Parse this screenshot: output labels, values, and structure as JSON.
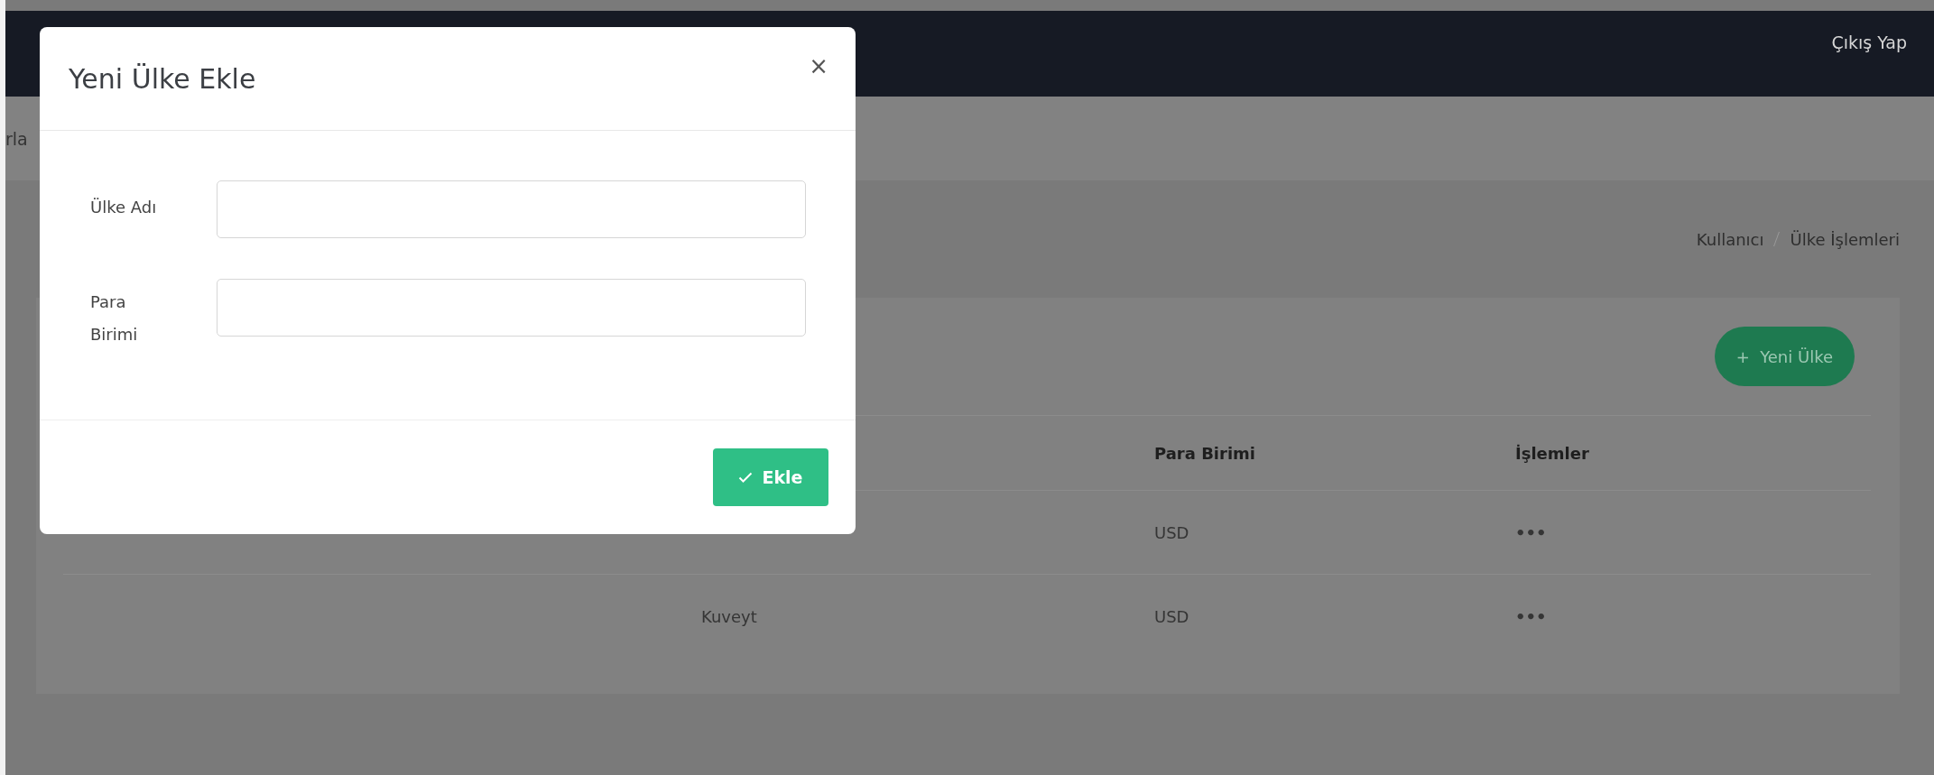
{
  "topbar": {
    "logout": "Çıkış Yap"
  },
  "nav": {
    "items": [
      "rla"
    ]
  },
  "breadcrumb": [
    "Kullanıcı",
    "Ülke İşlemleri"
  ],
  "add_button": {
    "icon": "+",
    "label": "Yeni Ülke"
  },
  "table": {
    "columns": [
      "Para Birimi",
      "İşlemler"
    ],
    "rows": [
      {
        "currency": "USD",
        "actions": "•••"
      },
      {
        "country": "Kuveyt",
        "currency": "USD",
        "actions": "•••"
      }
    ]
  },
  "modal": {
    "title": "Yeni Ülke Ekle",
    "close": "×",
    "fields": [
      {
        "label": "Ülke Adı"
      },
      {
        "label": "Para Birimi"
      }
    ],
    "submit": {
      "label": "Ekle"
    }
  }
}
